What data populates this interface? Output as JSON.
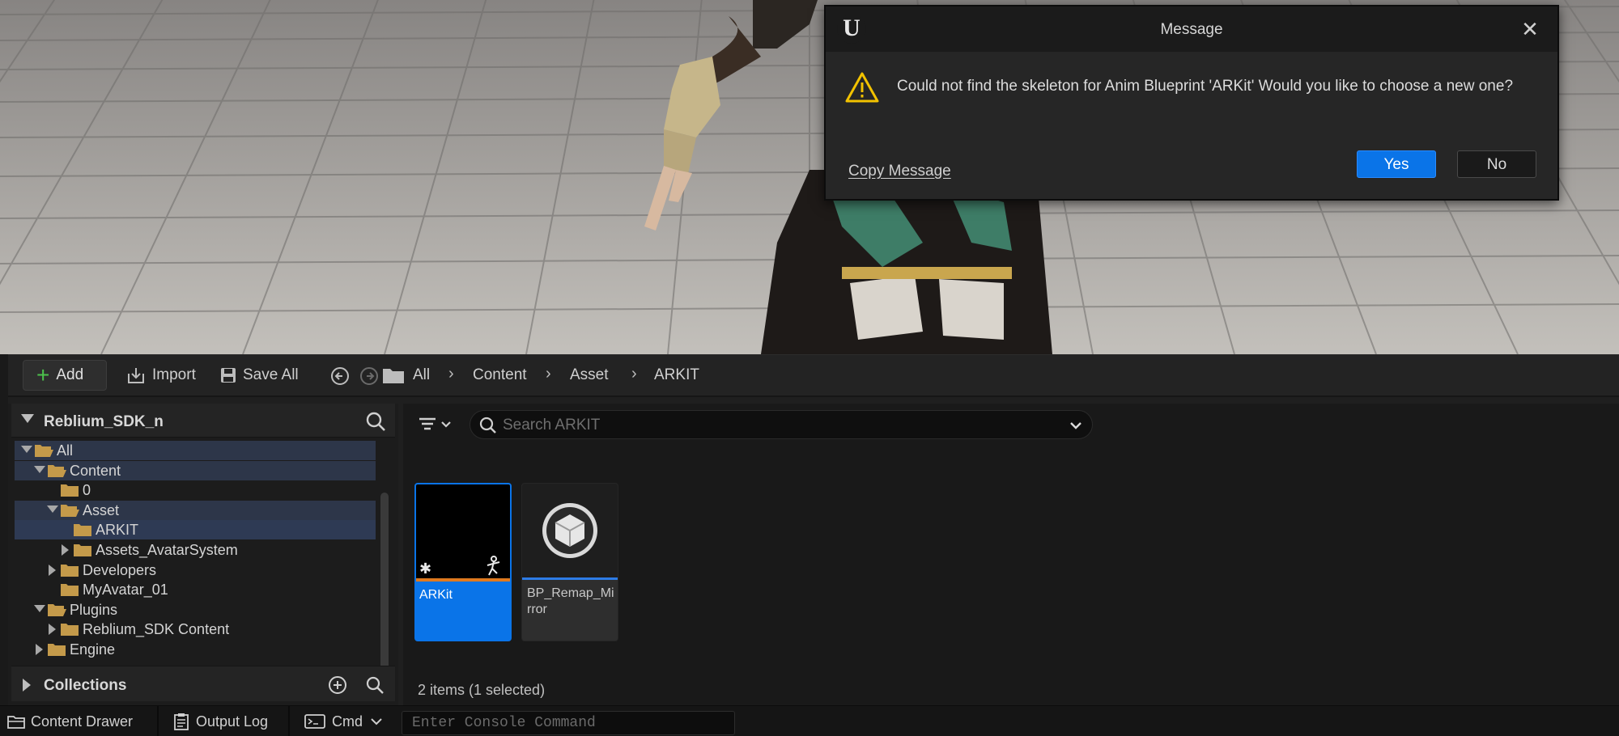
{
  "dialog": {
    "title": "Message",
    "logo_text": "U",
    "message": "Could not find the skeleton for Anim Blueprint 'ARKit' Would you like to choose a new one?",
    "copy_label": "Copy Message",
    "yes_label": "Yes",
    "no_label": "No",
    "icons": {
      "close": "close-icon",
      "warning": "warning-icon",
      "logo": "unreal-logo-icon"
    }
  },
  "toolbar": {
    "add_label": "Add",
    "import_label": "Import",
    "save_all_label": "Save All",
    "breadcrumbs": [
      "All",
      "Content",
      "Asset",
      "ARKIT"
    ]
  },
  "sources": {
    "header": "Reblium_SDK_n",
    "tree": [
      {
        "label": "All",
        "level": 0,
        "expanded": true
      },
      {
        "label": "Content",
        "level": 1,
        "expanded": true
      },
      {
        "label": "0",
        "level": 2
      },
      {
        "label": "Asset",
        "level": 2,
        "expanded": true
      },
      {
        "label": "ARKIT",
        "level": 3,
        "selected": true
      },
      {
        "label": "Assets_AvatarSystem",
        "level": 3,
        "expanded": false
      },
      {
        "label": "Developers",
        "level": 2,
        "expanded": false
      },
      {
        "label": "MyAvatar_01",
        "level": 2
      },
      {
        "label": "Plugins",
        "level": 1,
        "expanded": true
      },
      {
        "label": "Reblium_SDK Content",
        "level": 2,
        "expanded": false
      },
      {
        "label": "Engine",
        "level": 1,
        "expanded": false
      }
    ],
    "collections_label": "Collections"
  },
  "assets": {
    "search_placeholder": "Search ARKIT",
    "items": [
      {
        "name": "ARKit",
        "selected": true
      },
      {
        "name": "BP_Remap_Mirror",
        "selected": false
      }
    ],
    "count_text": "2 items (1 selected)"
  },
  "statusbar": {
    "content_drawer_label": "Content Drawer",
    "output_log_label": "Output Log",
    "cmd_label": "Cmd",
    "console_placeholder": "Enter Console Command"
  },
  "colors": {
    "accent_blue": "#0a74e8",
    "folder": "#c49a4a",
    "add_plus": "#4cc24c",
    "anim_bar": "#e07a1f"
  }
}
